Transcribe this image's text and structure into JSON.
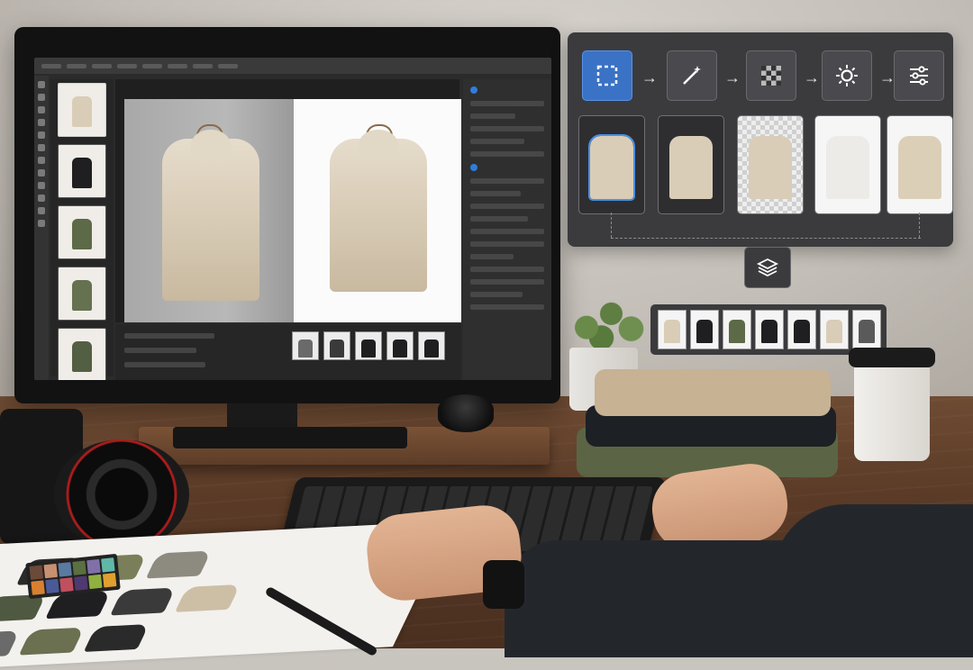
{
  "workflow": {
    "steps": [
      {
        "icon": "selection-icon"
      },
      {
        "icon": "magic-wand-icon"
      },
      {
        "icon": "checkerboard-icon"
      },
      {
        "icon": "sun-icon"
      },
      {
        "icon": "sliders-icon"
      }
    ],
    "merge_icon": "layers-icon"
  },
  "colors": {
    "accent": "#3a72c6",
    "panel_bg": "#3b3b3e",
    "beige_jacket": "#d9cdb8",
    "black_jacket": "#1f1f22",
    "olive_jacket": "#5d6a48"
  },
  "screen": {
    "left_thumbnails": [
      "beige",
      "black",
      "olive",
      "olive",
      "olive"
    ],
    "bottom_strip": [
      "gray",
      "dark",
      "black",
      "black",
      "black"
    ]
  },
  "output_strip": [
    "beige",
    "black",
    "olive",
    "black",
    "black",
    "beige",
    "gray"
  ]
}
